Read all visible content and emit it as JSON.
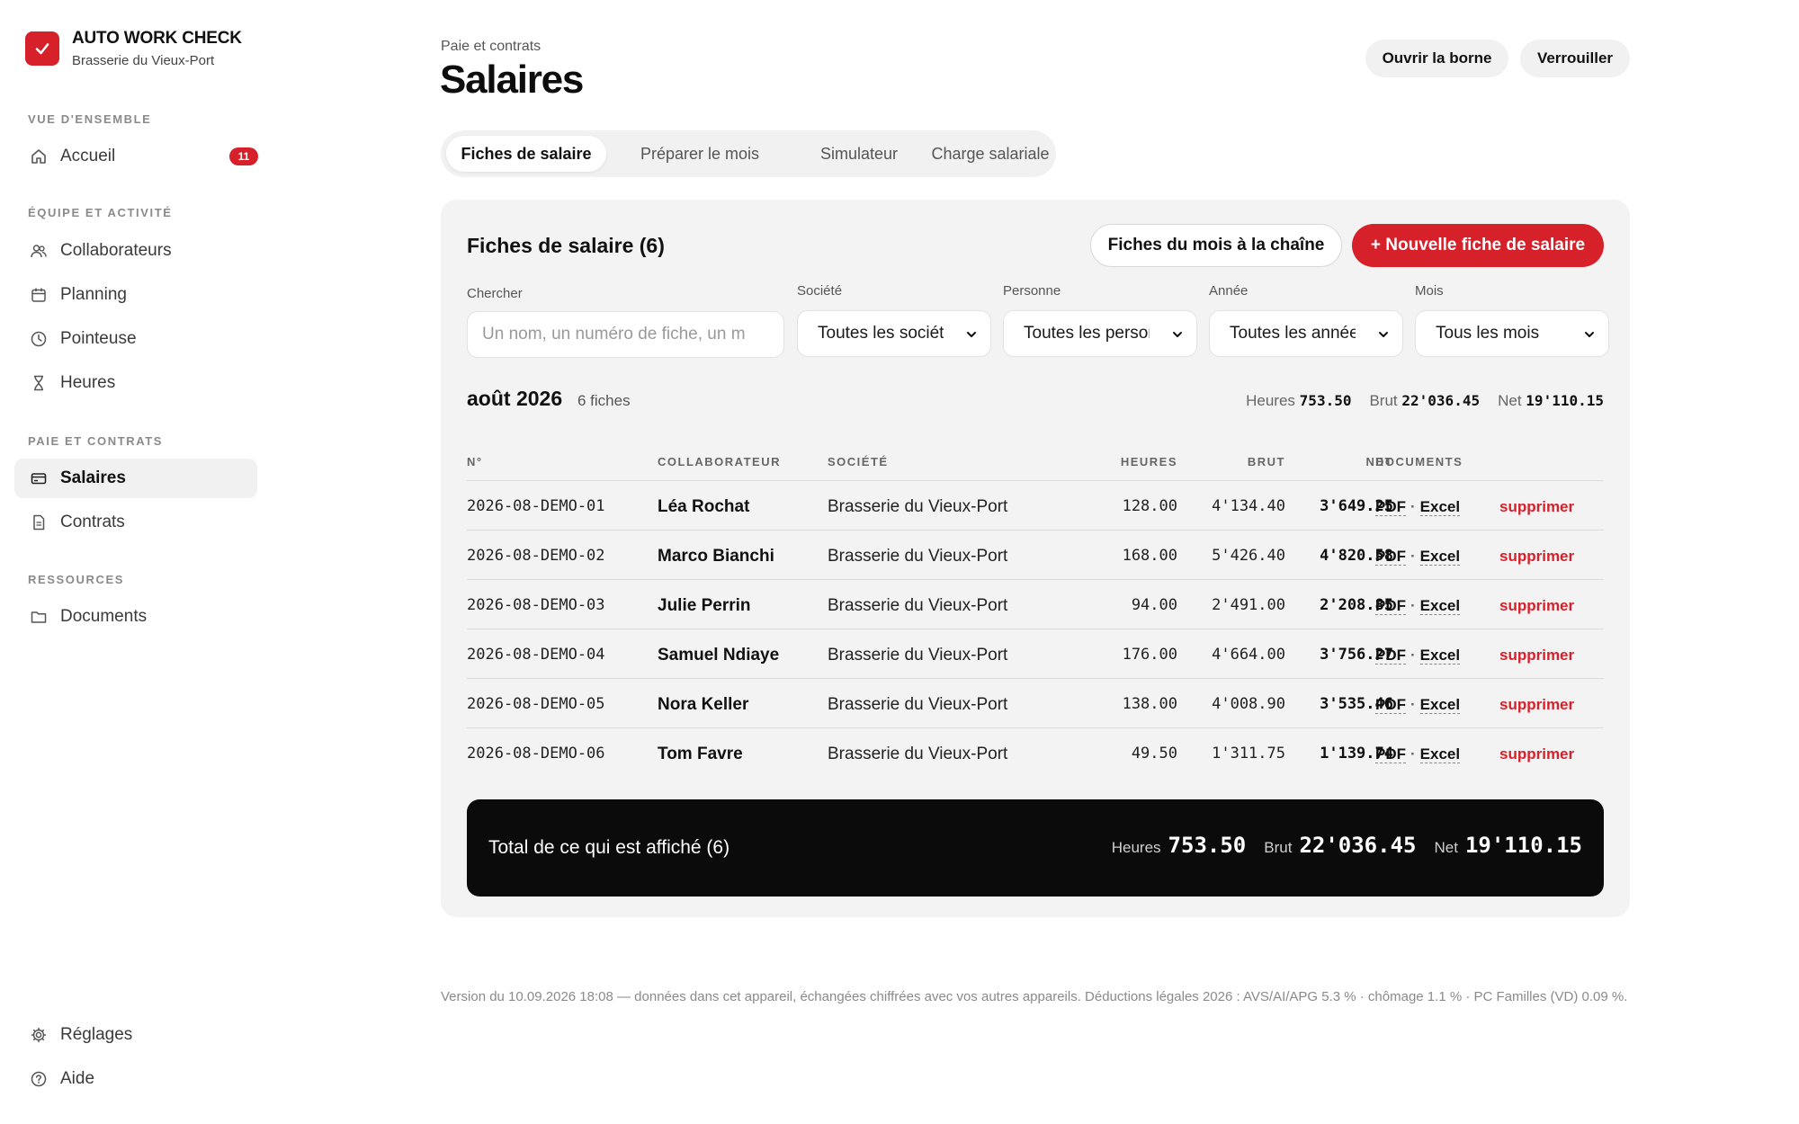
{
  "brand": {
    "name": "AUTO WORK CHECK",
    "subtitle": "Brasserie du Vieux-Port",
    "accent": "#d6202a"
  },
  "sidebar": {
    "sections": [
      {
        "title": "VUE D'ENSEMBLE"
      },
      {
        "title": "ÉQUIPE ET ACTIVITÉ"
      },
      {
        "title": "PAIE ET CONTRATS"
      },
      {
        "title": "RESSOURCES"
      }
    ],
    "items": [
      {
        "label": "Accueil",
        "icon": "home-icon",
        "badge": "11"
      },
      {
        "label": "Collaborateurs",
        "icon": "users-icon"
      },
      {
        "label": "Planning",
        "icon": "calendar-icon"
      },
      {
        "label": "Pointeuse",
        "icon": "clock-icon"
      },
      {
        "label": "Heures",
        "icon": "hourglass-icon"
      },
      {
        "label": "Salaires",
        "icon": "card-icon",
        "active": true
      },
      {
        "label": "Contrats",
        "icon": "document-icon"
      },
      {
        "label": "Documents",
        "icon": "folder-icon"
      },
      {
        "label": "Réglages",
        "icon": "gear-icon"
      },
      {
        "label": "Aide",
        "icon": "help-icon"
      }
    ]
  },
  "header": {
    "breadcrumb": "Paie et contrats",
    "title": "Salaires",
    "open_kiosk": "Ouvrir la borne",
    "lock": "Verrouiller"
  },
  "tabs": [
    {
      "label": "Fiches de salaire",
      "active": true
    },
    {
      "label": "Préparer le mois"
    },
    {
      "label": "Simulateur"
    },
    {
      "label": "Charge salariale"
    }
  ],
  "panel": {
    "title": "Fiches de salaire (6)",
    "chain_button": "Fiches du mois à la chaîne",
    "new_button": "+ Nouvelle fiche de salaire",
    "filters": {
      "search_label": "Chercher",
      "search_placeholder": "Un nom, un numéro de fiche, un m",
      "company_label": "Société",
      "company_value": "Toutes les sociétés",
      "person_label": "Personne",
      "person_value": "Toutes les personnes",
      "year_label": "Année",
      "year_value": "Toutes les années",
      "month_label": "Mois",
      "month_value": "Tous les mois"
    },
    "month": {
      "title": "août 2026",
      "count": "6 fiches",
      "hours_label": "Heures",
      "hours_value": "753.50",
      "gross_label": "Brut",
      "gross_value": "22'036.45",
      "net_label": "Net",
      "net_value": "19'110.15"
    },
    "columns": {
      "number": "N°",
      "employee": "COLLABORATEUR",
      "company": "SOCIÉTÉ",
      "hours": "HEURES",
      "gross": "BRUT",
      "net": "NET",
      "documents": "DOCUMENTS"
    },
    "rows": [
      {
        "number": "2026-08-DEMO-01",
        "employee": "Léa Rochat",
        "company": "Brasserie du Vieux-Port",
        "hours": "128.00",
        "gross": "4'134.40",
        "net": "3'649.25",
        "pdf": "PDF",
        "sep": "·",
        "excel": "Excel",
        "delete": "supprimer"
      },
      {
        "number": "2026-08-DEMO-02",
        "employee": "Marco Bianchi",
        "company": "Brasserie du Vieux-Port",
        "hours": "168.00",
        "gross": "5'426.40",
        "net": "4'820.58",
        "pdf": "PDF",
        "sep": "·",
        "excel": "Excel",
        "delete": "supprimer"
      },
      {
        "number": "2026-08-DEMO-03",
        "employee": "Julie Perrin",
        "company": "Brasserie du Vieux-Port",
        "hours": "94.00",
        "gross": "2'491.00",
        "net": "2'208.85",
        "pdf": "PDF",
        "sep": "·",
        "excel": "Excel",
        "delete": "supprimer"
      },
      {
        "number": "2026-08-DEMO-04",
        "employee": "Samuel Ndiaye",
        "company": "Brasserie du Vieux-Port",
        "hours": "176.00",
        "gross": "4'664.00",
        "net": "3'756.27",
        "pdf": "PDF",
        "sep": "·",
        "excel": "Excel",
        "delete": "supprimer"
      },
      {
        "number": "2026-08-DEMO-05",
        "employee": "Nora Keller",
        "company": "Brasserie du Vieux-Port",
        "hours": "138.00",
        "gross": "4'008.90",
        "net": "3'535.46",
        "pdf": "PDF",
        "sep": "·",
        "excel": "Excel",
        "delete": "supprimer"
      },
      {
        "number": "2026-08-DEMO-06",
        "employee": "Tom Favre",
        "company": "Brasserie du Vieux-Port",
        "hours": "49.50",
        "gross": "1'311.75",
        "net": "1'139.74",
        "pdf": "PDF",
        "sep": "·",
        "excel": "Excel",
        "delete": "supprimer"
      }
    ],
    "total": {
      "label": "Total de ce qui est affiché (6)",
      "hours_label": "Heures",
      "hours_value": "753.50",
      "gross_label": "Brut",
      "gross_value": "22'036.45",
      "net_label": "Net",
      "net_value": "19'110.15"
    }
  },
  "footer": "Version du 10.09.2026 18:08 — données dans cet appareil, échangées chiffrées avec vos autres appareils. Déductions légales 2026 : AVS/AI/APG 5.3 % · chômage 1.1 % · PC Familles (VD) 0.09 %."
}
